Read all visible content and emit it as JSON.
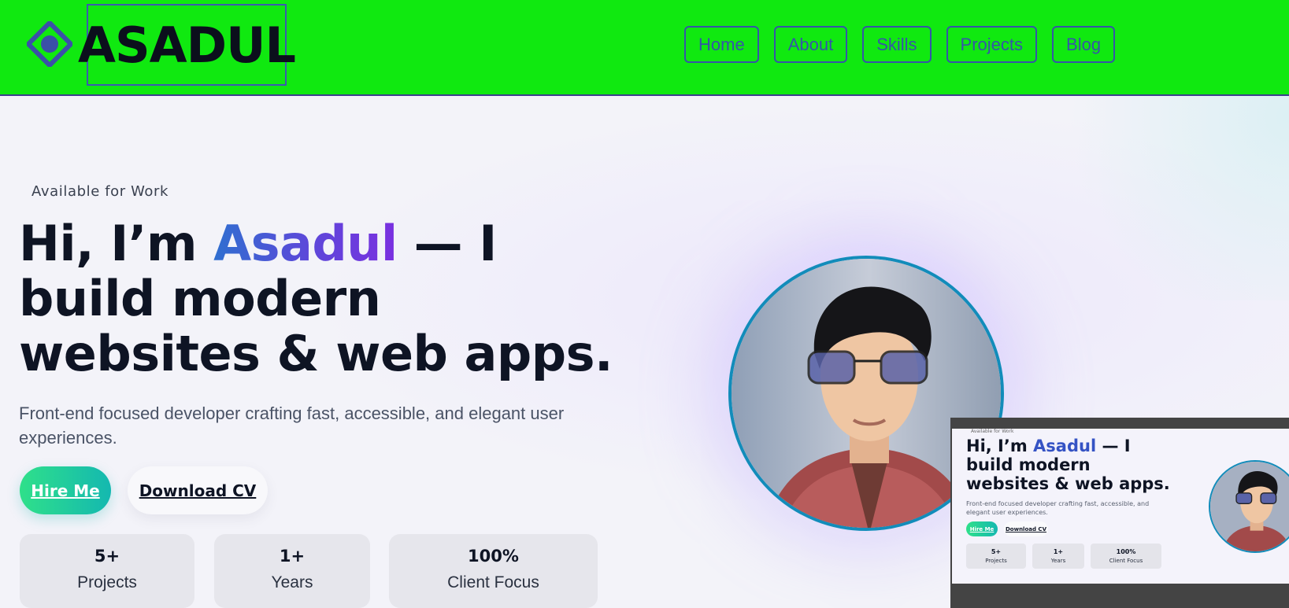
{
  "brand": {
    "name": "ASADUL"
  },
  "nav": {
    "items": [
      "Home",
      "About",
      "Skills",
      "Projects",
      "Blog"
    ]
  },
  "hero": {
    "badge": "Available for Work",
    "headline_pre": "Hi, I’m ",
    "headline_name": "Asadul",
    "headline_post1": " — I",
    "headline_line2": "build modern",
    "headline_line3": "websites & web apps.",
    "subtext": "Front-end focused developer crafting fast, accessible, and elegant user experiences.",
    "hire_label": "Hire Me",
    "cv_label": "Download CV",
    "stats": [
      {
        "value": "5+",
        "label": "Projects"
      },
      {
        "value": "1+",
        "label": "Years"
      },
      {
        "value": "100%",
        "label": "Client Focus"
      }
    ]
  },
  "colors": {
    "header_bg": "#10e910",
    "accent_blue": "#2f6fd0",
    "accent_purple": "#7a2fe0",
    "hire_gradient_start": "#2fe08a",
    "hire_gradient_end": "#14b8b0",
    "avatar_ring": "#128cba"
  },
  "icons": {
    "logo": "diamond-logo-icon"
  }
}
